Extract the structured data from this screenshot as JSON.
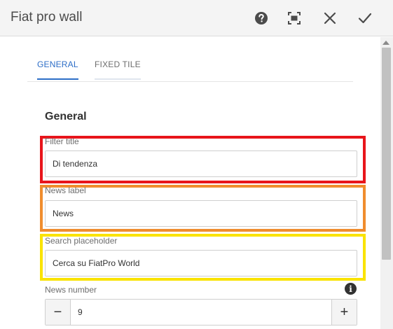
{
  "dialog": {
    "title": "Fiat pro wall"
  },
  "header_buttons": [
    "help-icon",
    "fullscreen-icon",
    "close-icon",
    "done-icon"
  ],
  "tabs": [
    {
      "label": "GENERAL",
      "active": true
    },
    {
      "label": "FIXED TILE",
      "active": false
    }
  ],
  "section": {
    "heading": "General"
  },
  "fields": {
    "filter_title": {
      "label": "Filter title",
      "value": "Di tendenza"
    },
    "news_label": {
      "label": "News label",
      "value": "News"
    },
    "search_placeholder": {
      "label": "Search placeholder",
      "value": "Cerca su FiatPro World"
    },
    "news_number": {
      "label": "News number",
      "value": "9",
      "minus": "−",
      "plus": "+",
      "info": "i"
    }
  },
  "highlights": {
    "red": "#e8151b",
    "orange": "#f08d2e",
    "yellow": "#fae300"
  },
  "colors": {
    "accent": "#2d6ec7",
    "header_bg": "#f4f4f4"
  }
}
